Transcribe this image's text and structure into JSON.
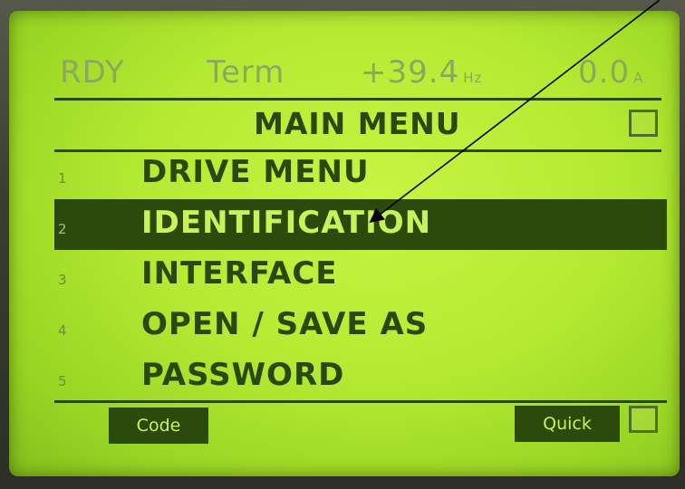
{
  "status": {
    "state": "RDY",
    "mode": "Term",
    "frequency": "+39.4",
    "frequency_unit": "Hz",
    "current": "0.0",
    "current_unit": "A"
  },
  "main_menu": {
    "title": "MAIN MENU",
    "items": [
      {
        "number": "1",
        "label": "DRIVE MENU",
        "selected": false
      },
      {
        "number": "2",
        "label": "IDENTIFICATION",
        "selected": true
      },
      {
        "number": "3",
        "label": "INTERFACE",
        "selected": false
      },
      {
        "number": "4",
        "label": "OPEN / SAVE AS",
        "selected": false
      },
      {
        "number": "5",
        "label": "PASSWORD",
        "selected": false
      }
    ]
  },
  "softkeys": {
    "left_label": "Code",
    "right_label": "Quick"
  },
  "colors": {
    "lcd_background": "#b4ea32",
    "lcd_ink": "#2b4a0c",
    "selected_text": "#c9f25a",
    "annotation_arrow": "#000000"
  }
}
